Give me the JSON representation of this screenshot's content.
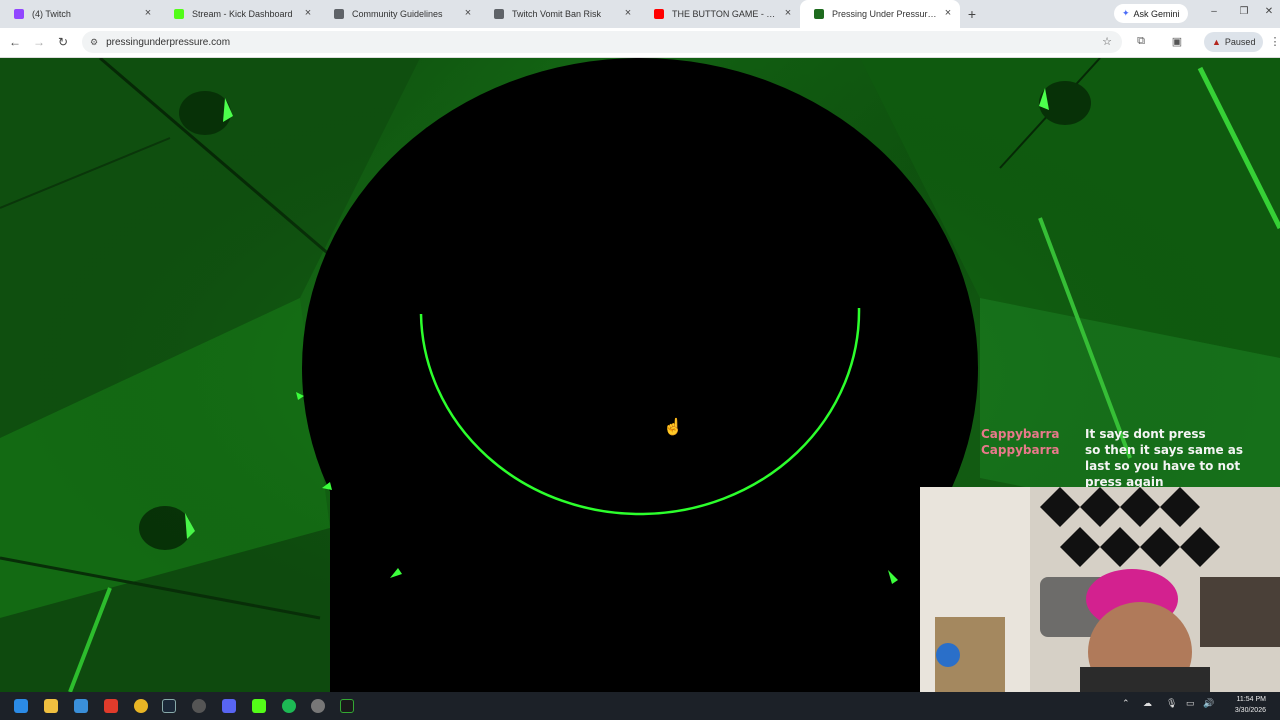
{
  "browser": {
    "tabs": [
      {
        "title": "(4) Twitch",
        "favicon": "twitch-icon",
        "color": "#9146ff"
      },
      {
        "title": "Stream - Kick Dashboard",
        "favicon": "kick-icon",
        "color": "#53fc18"
      },
      {
        "title": "Community Guidelines",
        "favicon": "globe-icon",
        "color": "#5f6368"
      },
      {
        "title": "Twitch Vomit Ban Risk",
        "favicon": "globe-icon",
        "color": "#5f6368"
      },
      {
        "title": "THE BUTTON GAME - YouTube",
        "favicon": "youtube-icon",
        "color": "#ff0000"
      },
      {
        "title": "Pressing Under Pressure |Game",
        "favicon": "game-icon",
        "color": "#1e6b1e",
        "active": true
      }
    ],
    "ask_gemini": "Ask Gemini",
    "url": "pressingunderpressure.com",
    "profile_status": "Paused"
  },
  "overlay": {
    "chat": [
      {
        "user": "Cappybarra",
        "message": "It says dont press"
      },
      {
        "user": "Cappybarra",
        "message": "so then it says same as last so you have to not press again"
      }
    ]
  },
  "taskbar": {
    "time": "11:54 PM",
    "date": "3/30/2026"
  },
  "colors": {
    "game_green": "#2cff2c",
    "chat_user": "#e8798b"
  }
}
